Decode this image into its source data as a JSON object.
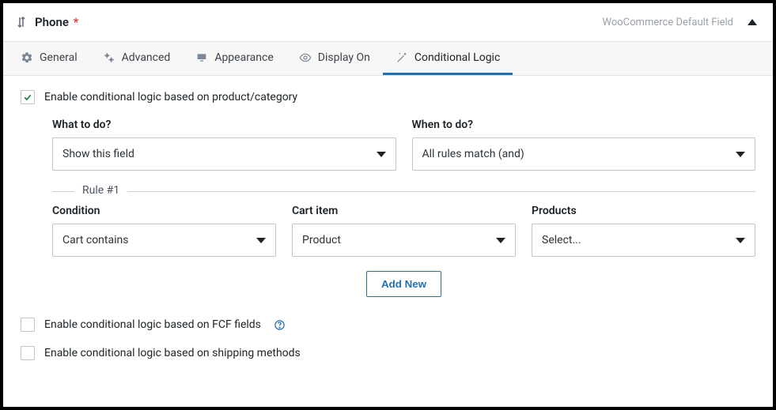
{
  "header": {
    "title": "Phone",
    "required_marker": "*",
    "field_type_label": "WooCommerce Default Field"
  },
  "tabs": {
    "general": "General",
    "advanced": "Advanced",
    "appearance": "Appearance",
    "display_on": "Display On",
    "conditional_logic": "Conditional Logic"
  },
  "checks": {
    "enable_product": "Enable conditional logic based on product/category",
    "enable_fcf": "Enable conditional logic based on FCF fields",
    "enable_shipping": "Enable conditional logic based on shipping methods"
  },
  "labels": {
    "what_to_do": "What to do?",
    "when_to_do": "When to do?",
    "rule1": "Rule #1",
    "condition": "Condition",
    "cart_item": "Cart item",
    "products": "Products"
  },
  "selects": {
    "what_to_do_value": "Show this field",
    "when_to_do_value": "All rules match (and)",
    "condition_value": "Cart contains",
    "cart_item_value": "Product",
    "products_value": "Select..."
  },
  "buttons": {
    "add_new": "Add New"
  }
}
